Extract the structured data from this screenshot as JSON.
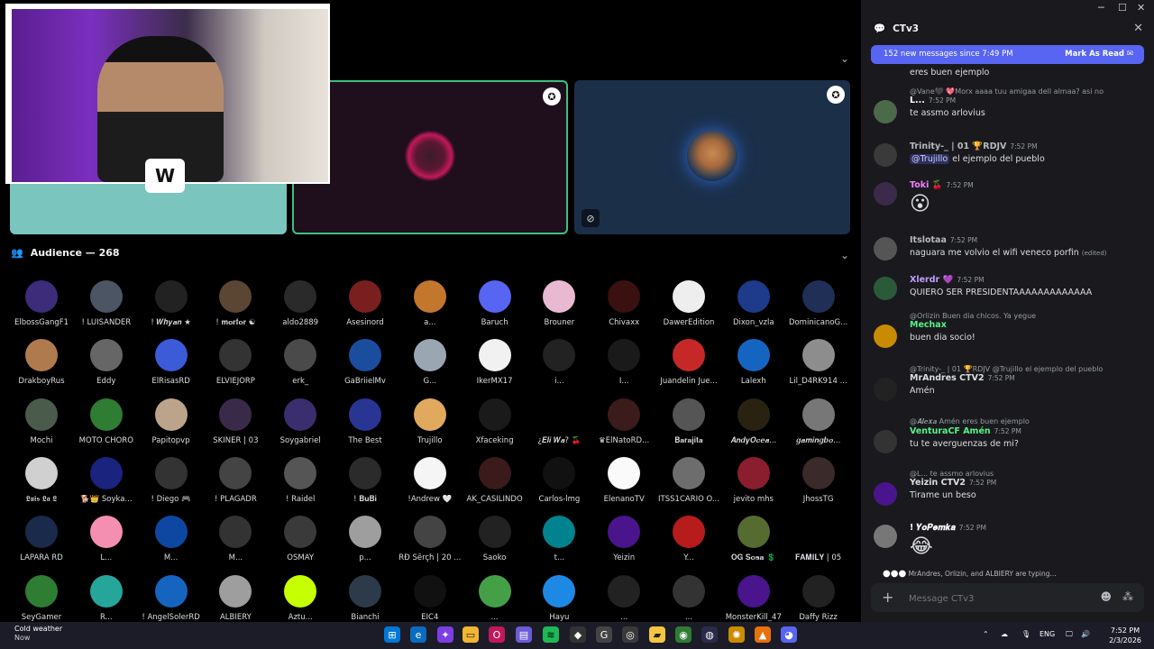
{
  "stage": {
    "audience_header": "Audience — 268",
    "members": [
      {
        "name": "ElbossGangF1",
        "color": "#3d2c7a"
      },
      {
        "name": "! LUISANDER",
        "color": "#4b5563"
      },
      {
        "name": "! 𝑾𝒉𝒚𝒂𝒏 ★",
        "color": "#222"
      },
      {
        "name": "! 𝐦𝐨𝐫𝐟𝐨𝐫 ☯",
        "color": "#5a4632"
      },
      {
        "name": "aldo2889",
        "color": "#2a2a2a"
      },
      {
        "name": "Asesinord",
        "color": "#7a1f1f"
      },
      {
        "name": "a...",
        "color": "#c2772d"
      },
      {
        "name": "Baruch",
        "color": "#5865f2"
      },
      {
        "name": "Brouner",
        "color": "#e9b9d2"
      },
      {
        "name": "Chivaxx",
        "color": "#3a1010"
      },
      {
        "name": "DawerEdition",
        "color": "#eeeeee"
      },
      {
        "name": "Dixon_vzla",
        "color": "#1e3a8a"
      },
      {
        "name": "DominicanoG...",
        "color": "#1f2f55"
      },
      {
        "name": "DrakboyRus",
        "color": "#b07a4f"
      },
      {
        "name": "Eddy",
        "color": "#666"
      },
      {
        "name": "ElRisasRD",
        "color": "#3b5bd9"
      },
      {
        "name": "ELVIEJORP",
        "color": "#333"
      },
      {
        "name": "erk_",
        "color": "#4a4a4a"
      },
      {
        "name": "GaBriielMv",
        "color": "#1b4d9e"
      },
      {
        "name": "G...",
        "color": "#9aa6b2"
      },
      {
        "name": "IkerMX17",
        "color": "#f1f1f1"
      },
      {
        "name": "i...",
        "color": "#222"
      },
      {
        "name": "I...",
        "color": "#1a1a1a"
      },
      {
        "name": "Juandelin Jue...",
        "color": "#c62828"
      },
      {
        "name": "Lalexh",
        "color": "#1565c0"
      },
      {
        "name": "Lil_D4RK914 ...",
        "color": "#8d8d8d"
      },
      {
        "name": "Mochi",
        "color": "#4b5b4b"
      },
      {
        "name": "MOTO CHORO",
        "color": "#2e7d32"
      },
      {
        "name": "Papitopvp",
        "color": "#bca48a"
      },
      {
        "name": "SKINER | 03",
        "color": "#3a2a4a"
      },
      {
        "name": "Soygabriel",
        "color": "#3b2e6e"
      },
      {
        "name": "The Best",
        "color": "#283593"
      },
      {
        "name": "Trujillo",
        "color": "#e0a95e"
      },
      {
        "name": "Xfaceking",
        "color": "#1a1a1a"
      },
      {
        "name": "¿𝑬𝒍𝒊 𝑾𝒂? 🍒",
        "color": "#000"
      },
      {
        "name": "♛ElNatoRD...",
        "color": "#3b1b1b"
      },
      {
        "name": "𝐁𝐚𝐫𝐚𝐣𝐢𝐭𝐚",
        "color": "#555"
      },
      {
        "name": "𝑨𝒏𝒅𝒚𝑶𝒄𝒆𝒂...",
        "color": "#2a2210"
      },
      {
        "name": "𝒈𝒂𝒎𝒊𝒏𝒈𝒃𝒐...",
        "color": "#777"
      },
      {
        "name": "𝕷𝖚𝖎𝖘 𝕷𝖆 𝕷",
        "color": "#d0d0d0"
      },
      {
        "name": "🐕👑 Soyka...",
        "color": "#1a237e"
      },
      {
        "name": "! Diego 🎮",
        "color": "#333"
      },
      {
        "name": "! PLAGADR",
        "color": "#444"
      },
      {
        "name": "! Raidel",
        "color": "#555"
      },
      {
        "name": "! 𝐁𝐮𝐁𝐢",
        "color": "#2b2b2b"
      },
      {
        "name": "!Andrew 🤍",
        "color": "#f5f5f5"
      },
      {
        "name": "AK_CASILINDO",
        "color": "#3a1a1a"
      },
      {
        "name": "Carlos-lmg",
        "color": "#111"
      },
      {
        "name": "ElenanoTV",
        "color": "#fafafa"
      },
      {
        "name": "ITSS1CARIO O...",
        "color": "#6d6d6d"
      },
      {
        "name": "jevito mhs",
        "color": "#8b1e2e"
      },
      {
        "name": "JhossTG",
        "color": "#3a2a2a"
      },
      {
        "name": "LAPARA RD",
        "color": "#1a2a4a"
      },
      {
        "name": "L...",
        "color": "#f48fb1"
      },
      {
        "name": "M...",
        "color": "#0d47a1"
      },
      {
        "name": "M...",
        "color": "#333"
      },
      {
        "name": "OSMAY",
        "color": "#3a3a3a"
      },
      {
        "name": "p...",
        "color": "#9e9e9e"
      },
      {
        "name": "RĐ Šērçh | 20 ...",
        "color": "#444"
      },
      {
        "name": "Saoko",
        "color": "#222"
      },
      {
        "name": "t...",
        "color": "#00838f"
      },
      {
        "name": "Yeizin",
        "color": "#4a148c"
      },
      {
        "name": "Y...",
        "color": "#b71c1c"
      },
      {
        "name": "𝐎𝐆 𝐒𝐨𝐬𝐚 💲",
        "color": "#556b2f"
      },
      {
        "name": "𝐅𝐀𝐌𝐈𝐋𝐘 | 05",
        "color": "#000"
      },
      {
        "name": "SeyGamer",
        "color": "#2e7d32"
      },
      {
        "name": "R...",
        "color": "#26a69a"
      },
      {
        "name": "! AngelSolerRD",
        "color": "#1565c0"
      },
      {
        "name": "ALBIERY",
        "color": "#9e9e9e"
      },
      {
        "name": "Aztu...",
        "color": "#c6ff00"
      },
      {
        "name": "Bianchi",
        "color": "#2d3a4a"
      },
      {
        "name": "EIC4",
        "color": "#111"
      },
      {
        "name": "...",
        "color": "#43a047"
      },
      {
        "name": "Hayu",
        "color": "#1e88e5"
      },
      {
        "name": "...",
        "color": "#222"
      },
      {
        "name": "...",
        "color": "#333"
      },
      {
        "name": "MonsterKill_47",
        "color": "#4a148c"
      },
      {
        "name": "Daffy Rizz",
        "color": "#222"
      }
    ]
  },
  "chat": {
    "title": "CTv3",
    "new_messages": "152 new messages since 7:49 PM",
    "mark_as_read": "Mark As Read",
    "top_text": "eres buen ejemplo",
    "messages": [
      {
        "reply": "@Vane🖤  💖Morx  aaaa tuu amigaa dell almaa? asi no",
        "author": "L...",
        "time": "7:52 PM",
        "text": "te assmo arlovius",
        "color": "#fff",
        "avatar": "#4a6a4a"
      },
      {
        "reply": "",
        "author": "Trinity-_ | 01  🏆RDJV",
        "time": "7:52 PM",
        "text": "el ejemplo del pueblo",
        "mention": "@Trujillo",
        "color": "#b5bac1",
        "avatar": "#3a3a3a"
      },
      {
        "reply": "",
        "author": "Toki 🍒",
        "time": "7:52 PM",
        "text": "😮",
        "color": "#f47fff",
        "avatar": "#3b2a4a"
      },
      {
        "reply": "",
        "author": "Itslotaa",
        "time": "7:52 PM",
        "text": "naguara me volvio el wifi veneco porfin",
        "edited": "(edited)",
        "color": "#b5bac1",
        "avatar": "#555"
      },
      {
        "reply": "",
        "author": "Xlerdr 💜",
        "time": "7:52 PM",
        "text": "QUIERO SER PRESIDENTAAAAAAAAAAAAA",
        "color": "#c59bff",
        "avatar": "#2a5a3a"
      },
      {
        "reply": "@Orlizin  Buen dia chicos. Ya yegue",
        "author": "Mechax",
        "time": "",
        "text": "buen dia socio!",
        "color": "#57f287",
        "avatar": "#c98b00"
      },
      {
        "reply": "@Trinity-_ | 01  🏆RDJV  @Trujillo el ejemplo del pueblo",
        "author": "MrAndres  CTV2",
        "time": "7:52 PM",
        "text": "Amén",
        "color": "#dbdee1",
        "avatar": "#222"
      },
      {
        "reply": "@𝑨𝒍𝒆𝒙𝒂  Amén  eres buen ejemplo",
        "author": "VenturaCF  Amén",
        "time": "7:52 PM",
        "text": "tu te averguenzas de mi?",
        "color": "#57f287",
        "avatar": "#333"
      },
      {
        "reply": "@L...  te assmo arlovius",
        "author": "Yeizin  CTV2",
        "time": "7:52 PM",
        "text": "Tirame un beso",
        "color": "#dbdee1",
        "avatar": "#4a148c"
      },
      {
        "reply": "",
        "author": "! 𝒀𝒐𝑷𝒆𝒎𝒌𝒂",
        "time": "7:52 PM",
        "text": "😂",
        "color": "#fff",
        "avatar": "#777"
      }
    ],
    "typing": "MrAndres, Orlizin, and ALBIERY are typing...",
    "composer_placeholder": "Message CTv3"
  },
  "taskbar": {
    "weather_title": "Cold weather",
    "weather_sub": "Now",
    "lang": "ENG",
    "time": "7:52 PM",
    "date": "2/3/2026"
  }
}
